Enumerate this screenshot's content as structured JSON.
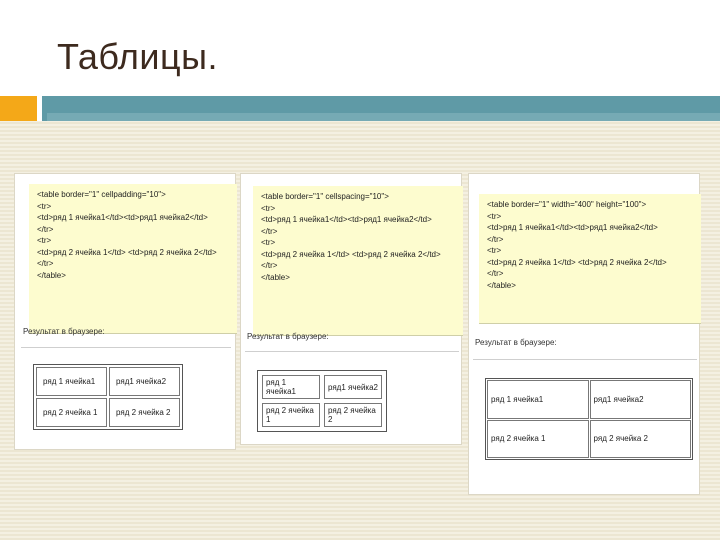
{
  "slide": {
    "title": "Таблицы."
  },
  "colors": {
    "accent_orange": "#f4a818",
    "accent_teal": "#5f9aa6",
    "code_bg": "#fdfccf"
  },
  "examples": [
    {
      "code": "<table border=\"1\" cellpadding=\"10\">\n<tr>\n<td>ряд 1 ячейка1</td><td>ряд1 ячейка2</td>\n</tr>\n<tr>\n<td>ряд 2 ячейка 1</td> <td>ряд 2 ячейка 2</td>\n</tr>\n</table>",
      "result_label": "Результат в браузере:",
      "cells": [
        [
          "ряд 1 ячейка1",
          "ряд1 ячейка2"
        ],
        [
          "ряд 2 ячейка 1",
          "ряд 2 ячейка 2"
        ]
      ]
    },
    {
      "code": "<table border=\"1\" cellspacing=\"10\">\n<tr>\n<td>ряд 1 ячейка1</td><td>ряд1 ячейка2</td>\n</tr>\n<tr>\n<td>ряд 2 ячейка 1</td> <td>ряд 2 ячейка 2</td>\n</tr>\n</table>",
      "result_label": "Результат в браузере:",
      "cells": [
        [
          "ряд 1 ячейка1",
          "ряд1 ячейка2"
        ],
        [
          "ряд 2 ячейка 1",
          "ряд 2 ячейка 2"
        ]
      ]
    },
    {
      "code": "<table border=\"1\" width=\"400\" height=\"100\">\n<tr>\n<td>ряд 1 ячейка1</td><td>ряд1 ячейка2</td>\n</tr>\n<tr>\n<td>ряд 2 ячейка 1</td> <td>ряд 2 ячейка 2</td>\n</tr>\n</table>",
      "result_label": "Результат в браузере:",
      "cells": [
        [
          "ряд 1 ячейка1",
          "ряд1 ячейка2"
        ],
        [
          "ряд 2 ячейка 1",
          "ряд 2 ячейка 2"
        ]
      ]
    }
  ]
}
